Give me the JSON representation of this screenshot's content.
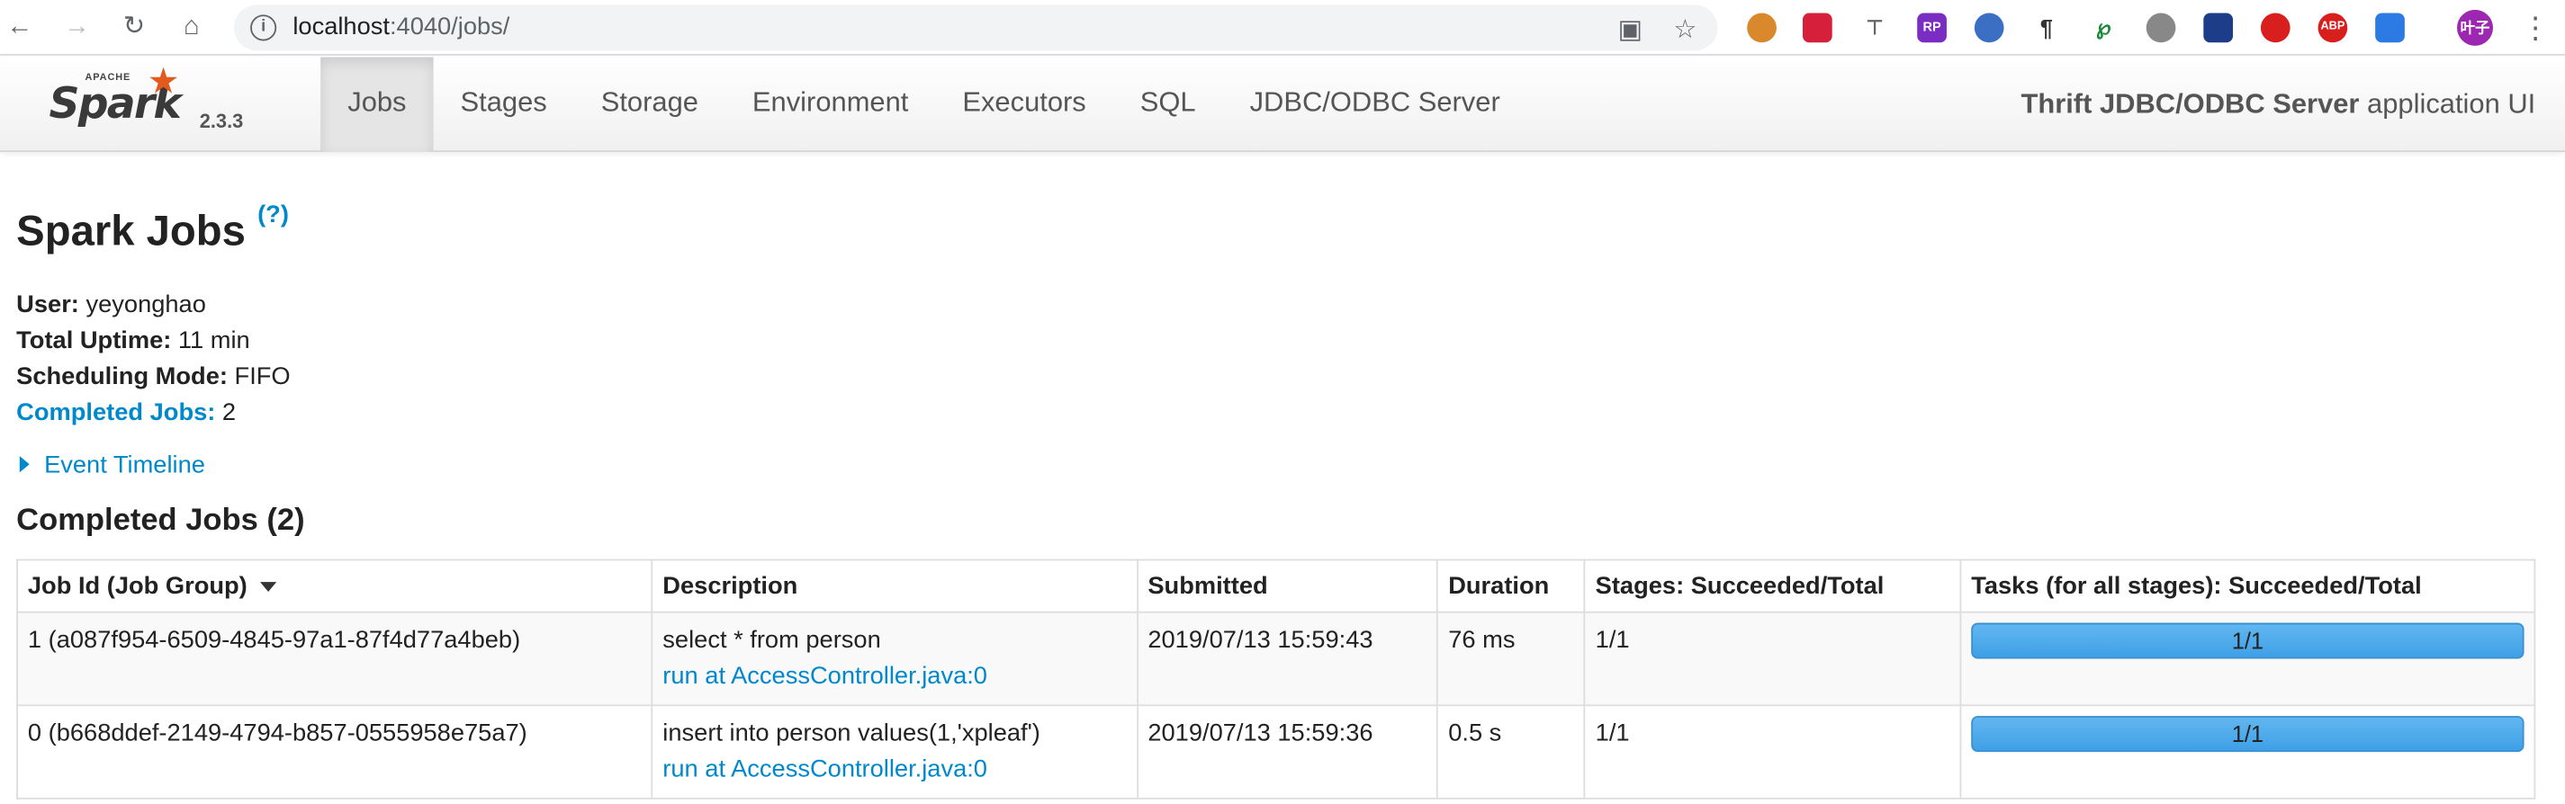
{
  "browser": {
    "url_host": "localhost",
    "url_path": ":4040/jobs/",
    "profile_label": "叶子"
  },
  "navbar": {
    "brand_apache": "APACHE",
    "brand_name": "Spark",
    "version": "2.3.3",
    "tabs": [
      "Jobs",
      "Stages",
      "Storage",
      "Environment",
      "Executors",
      "SQL",
      "JDBC/ODBC Server"
    ],
    "active_tab": "Jobs",
    "app_title_bold": "Thrift JDBC/ODBC Server",
    "app_title_rest": " application UI"
  },
  "page": {
    "title": "Spark Jobs",
    "help": "(?)",
    "summary": {
      "user_label": "User:",
      "user_value": " yeyonghao",
      "uptime_label": "Total Uptime:",
      "uptime_value": " 11 min",
      "mode_label": "Scheduling Mode:",
      "mode_value": " FIFO",
      "completed_label": "Completed Jobs:",
      "completed_value": " 2"
    },
    "event_timeline": "Event Timeline",
    "section_title": "Completed Jobs (2)"
  },
  "table": {
    "headers": [
      "Job Id (Job Group)",
      "Description",
      "Submitted",
      "Duration",
      "Stages: Succeeded/Total",
      "Tasks (for all stages): Succeeded/Total"
    ],
    "rows": [
      {
        "job_id": "1 (a087f954-6509-4845-97a1-87f4d77a4beb)",
        "description": "select * from person",
        "callsite": "run at AccessController.java:0",
        "submitted": "2019/07/13 15:59:43",
        "duration": "76 ms",
        "stages": "1/1",
        "tasks": "1/1",
        "tasks_progress": 1.0
      },
      {
        "job_id": "0 (b668ddef-2149-4794-b857-0555958e75a7)",
        "description": "insert into person values(1,'xpleaf')",
        "callsite": "run at AccessController.java:0",
        "submitted": "2019/07/13 15:59:36",
        "duration": "0.5 s",
        "stages": "1/1",
        "tasks": "1/1",
        "tasks_progress": 1.0
      }
    ]
  },
  "colors": {
    "link": "#0088cc",
    "progress": "#3fa0e6",
    "spark_orange": "#e25a1c"
  }
}
